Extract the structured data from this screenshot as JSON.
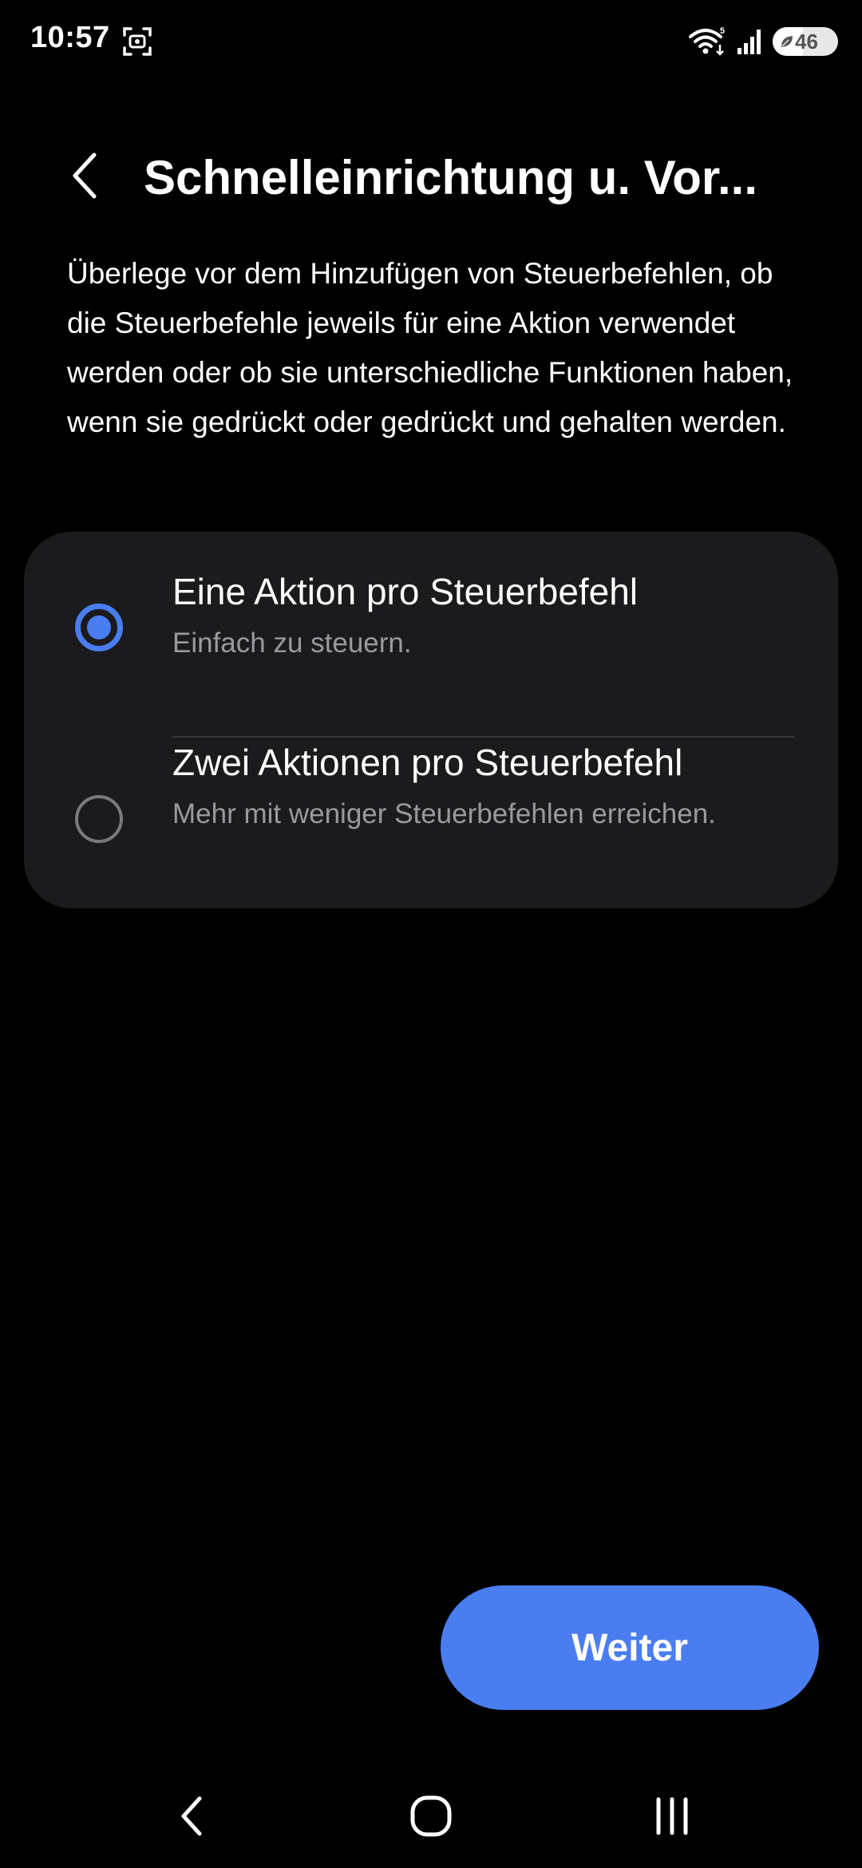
{
  "status_bar": {
    "time": "10:57",
    "battery_level": "46",
    "wifi_generation": "5",
    "icons": [
      "screen-capture-icon",
      "wifi-icon",
      "signal-icon",
      "battery-icon"
    ]
  },
  "header": {
    "title": "Schnelleinrichtung u. Vor...",
    "back_icon": "chevron-left-icon"
  },
  "description": "Überlege vor dem Hinzufügen von Steuerbefehlen, ob die Steuerbefehle jeweils für eine Aktion verwendet werden oder ob sie unterschiedliche Funktionen haben, wenn sie gedrückt oder gedrückt und gehalten werden.",
  "options": [
    {
      "title": "Eine Aktion pro Steuerbefehl",
      "subtitle": "Einfach zu steuern.",
      "selected": true
    },
    {
      "title": "Zwei Aktionen pro Steuerbefehl",
      "subtitle": "Mehr mit weniger Steuerbefehlen erreichen.",
      "selected": false
    }
  ],
  "next_button": {
    "label": "Weiter"
  },
  "colors": {
    "accent": "#4a7df0",
    "background": "#000000",
    "card": "#1b1b1d",
    "secondary_text": "#9a9a9e"
  },
  "nav_bar": {
    "icons": [
      "nav-back-icon",
      "nav-home-icon",
      "nav-recents-icon"
    ]
  }
}
